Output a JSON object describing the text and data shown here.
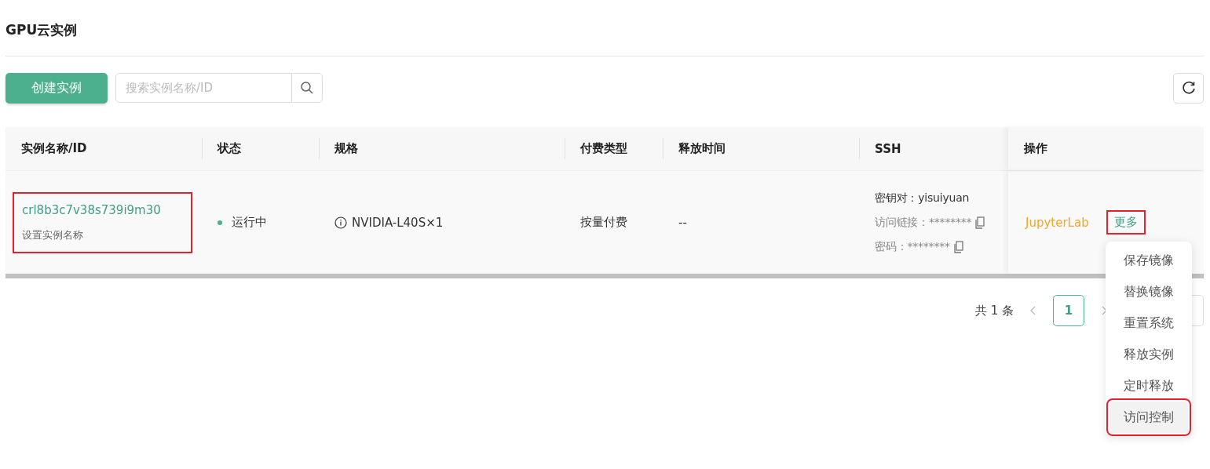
{
  "page": {
    "title": "GPU云实例"
  },
  "toolbar": {
    "create_button": "创建实例",
    "search": {
      "placeholder": "搜索实例名称/ID"
    }
  },
  "table": {
    "columns": [
      "实例名称/ID",
      "状态",
      "规格",
      "付费类型",
      "释放时间",
      "SSH",
      "操作"
    ],
    "rows": [
      {
        "id": "crl8b3c7v38s739i9m30",
        "rename_link": "设置实例名称",
        "id_highlighted": true,
        "status": "运行中",
        "spec": "NVIDIA-L40S×1",
        "billing": "按量付费",
        "release_time": "--",
        "ssh": [
          {
            "label": "密钥对：",
            "value": "yisuiyuan",
            "copyable": false
          },
          {
            "label": "访问链接：",
            "value": "********",
            "copyable": true
          },
          {
            "label": "密码：",
            "value": "********",
            "copyable": true
          }
        ],
        "actions": [
          {
            "kind": "jupyter",
            "label": "JupyterLab",
            "highlighted": false
          },
          {
            "kind": "more",
            "label": "更多",
            "highlighted": true
          }
        ]
      }
    ]
  },
  "pagination": {
    "total": "共 1 条",
    "pages": [
      {
        "label": "1",
        "selected": true
      }
    ]
  },
  "menu": {
    "items": [
      {
        "label": "保存镜像",
        "selected": false,
        "highlighted": false
      },
      {
        "label": "替换镜像",
        "selected": false,
        "highlighted": false
      },
      {
        "label": "重置系统",
        "selected": false,
        "highlighted": false
      },
      {
        "label": "释放实例",
        "selected": false,
        "highlighted": false
      },
      {
        "label": "定时释放",
        "selected": false,
        "highlighted": false
      },
      {
        "label": "访问控制",
        "selected": true,
        "highlighted": true
      }
    ]
  }
}
